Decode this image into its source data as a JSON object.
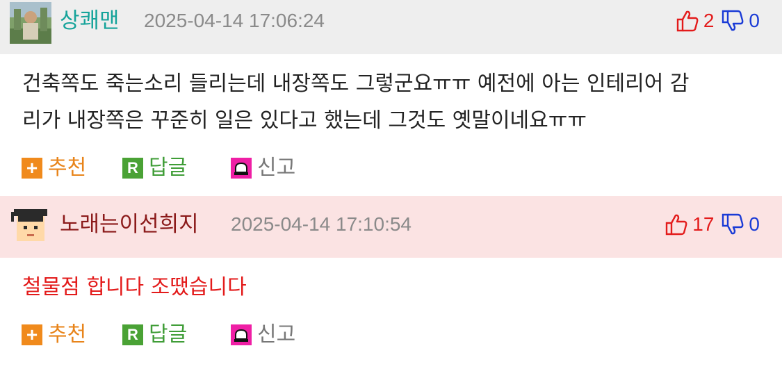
{
  "comments": [
    {
      "nickname": "상쾌맨",
      "date": "2025-04-14 17:06:24",
      "upvotes": "2",
      "downvotes": "0",
      "text_lines": [
        "건축쪽도 죽는소리 들리는데 내장쪽도 그렇군요ㅠㅠ 예전에 아는 인테리어 감",
        "리가 내장쪽은 꾸준히 일은 있다고 했는데 그것도 옛말이네요ㅠㅠ"
      ],
      "nickname_color": "#15a39a",
      "text_color": "#222222",
      "header_bg": "#eeeeee"
    },
    {
      "nickname": "노래는이선희지",
      "date": "2025-04-14 17:10:54",
      "upvotes": "17",
      "downvotes": "0",
      "text_lines": [
        "철물점 합니다 조땠습니다"
      ],
      "nickname_color": "#8b1a1a",
      "text_color": "#e31b1b",
      "header_bg": "#fbe3e3"
    }
  ],
  "actions": {
    "recommend_label": "추천",
    "reply_label": "답글",
    "reply_icon_letter": "R",
    "report_label": "신고",
    "recommend_icon_glyph": "+"
  },
  "icons": {
    "upvote": "thumbs-up-icon",
    "downvote": "thumbs-down-icon",
    "recommend": "plus-icon",
    "reply": "reply-icon",
    "report": "siren-icon"
  },
  "colors": {
    "upvote": "#e31b1b",
    "downvote": "#1a3bd6",
    "recommend": "#f08a1c",
    "reply": "#4aa235",
    "report": "#ef1fa5"
  }
}
